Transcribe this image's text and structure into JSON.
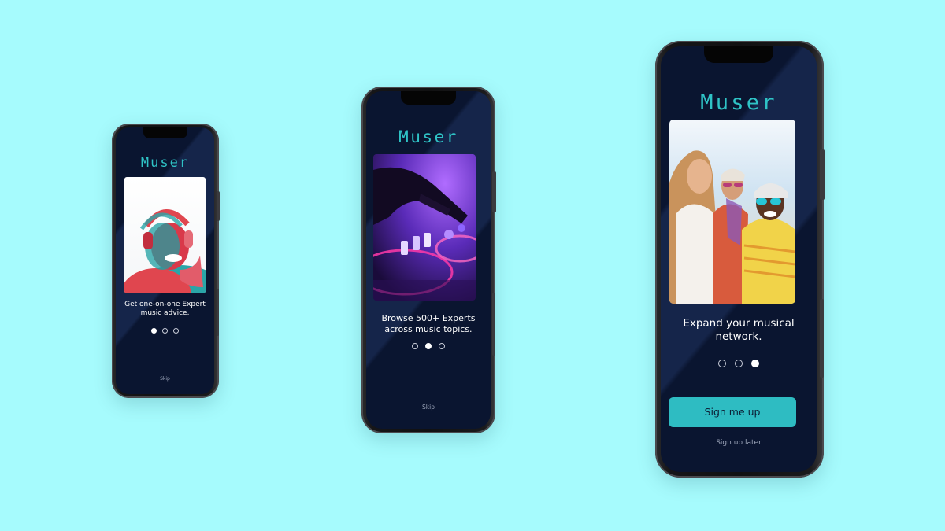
{
  "app": {
    "name": "Muser"
  },
  "colors": {
    "background": "#a6fbfd",
    "screen": "#0a1530",
    "accent": "#2fc3c6",
    "button": "#2ebcc2"
  },
  "screens": [
    {
      "logo": "Muser",
      "image": "woman-with-headphones-photo",
      "caption": "Get one-on-one Expert music advice.",
      "page_index": 1,
      "page_count": 3,
      "skip_label": "Skip"
    },
    {
      "logo": "Muser",
      "image": "dj-turntable-photo",
      "caption": "Browse 500+ Experts across music topics.",
      "page_index": 2,
      "page_count": 3,
      "skip_label": "Skip"
    },
    {
      "logo": "Muser",
      "image": "friends-with-sunglasses-photo",
      "caption": "Expand your musical network.",
      "page_index": 3,
      "page_count": 3,
      "primary_button": "Sign me up",
      "secondary_link": "Sign up later"
    }
  ]
}
